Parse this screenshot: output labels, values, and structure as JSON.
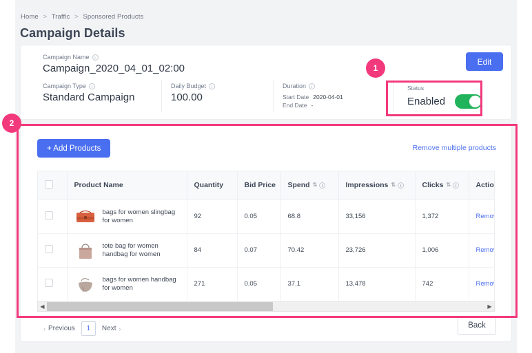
{
  "breadcrumb": {
    "items": [
      "Home",
      "Traffic",
      "Sponsored Products"
    ],
    "separator": ">"
  },
  "page_title": "Campaign Details",
  "campaign": {
    "name_label": "Campaign Name",
    "name_value": "Campaign_2020_04_01_02:00",
    "type_label": "Campaign Type",
    "type_value": "Standard Campaign",
    "budget_label": "Daily Budget",
    "budget_value": "100.00",
    "duration_label": "Duration",
    "start_label": "Start Date",
    "start_value": "2020-04-01",
    "end_label": "End Date",
    "end_value": "-",
    "status_label": "Status",
    "status_value": "Enabled",
    "edit_label": "Edit",
    "toggle_color": "#21b35b",
    "accent_color": "#4a6ef0"
  },
  "products": {
    "add_label": "+ Add Products",
    "remove_multiple_label": "Remove multiple products",
    "columns": [
      {
        "key": "checkbox",
        "label": "",
        "sortable": false,
        "info": false
      },
      {
        "key": "name",
        "label": "Product Name",
        "sortable": false,
        "info": false
      },
      {
        "key": "quantity",
        "label": "Quantity",
        "sortable": false,
        "info": false
      },
      {
        "key": "bid",
        "label": "Bid Price",
        "sortable": false,
        "info": false
      },
      {
        "key": "spend",
        "label": "Spend",
        "sortable": true,
        "info": true
      },
      {
        "key": "impressions",
        "label": "Impressions",
        "sortable": true,
        "info": true
      },
      {
        "key": "clicks",
        "label": "Clicks",
        "sortable": true,
        "info": true
      },
      {
        "key": "action",
        "label": "Action",
        "sortable": false,
        "info": false
      }
    ],
    "rows": [
      {
        "name": "bags for women slingbag for women",
        "quantity": "92",
        "bid": "0.05",
        "spend": "68.8",
        "impressions": "33,156",
        "clicks": "1,372",
        "action": "Remove",
        "thumb_color": "#d9603f"
      },
      {
        "name": "tote bag for women handbag for women",
        "quantity": "84",
        "bid": "0.07",
        "spend": "70.42",
        "impressions": "23,726",
        "clicks": "1,006",
        "action": "Remove",
        "thumb_color": "#c9a79c"
      },
      {
        "name": "bags for women handbag for women",
        "quantity": "271",
        "bid": "0.05",
        "spend": "37.1",
        "impressions": "13,478",
        "clicks": "742",
        "action": "Remove",
        "thumb_color": "#b9a79d"
      }
    ]
  },
  "pagination": {
    "previous_label": "Previous",
    "next_label": "Next",
    "current_page": "1",
    "back_label": "Back"
  },
  "annotations": [
    {
      "id": "1",
      "target": "status-toggle",
      "color": "#f2397c"
    },
    {
      "id": "2",
      "target": "products-panel",
      "color": "#f2397c"
    }
  ]
}
